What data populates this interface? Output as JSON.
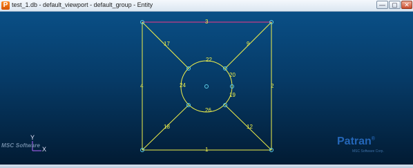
{
  "window": {
    "title": "test_1.db - default_viewport - default_group - Entity",
    "app_icon": "P",
    "buttons": [
      {
        "name": "minimize-button",
        "glyph": "—"
      },
      {
        "name": "maximize-button",
        "glyph": "▢"
      },
      {
        "name": "close-button",
        "glyph": "✕"
      }
    ]
  },
  "model": {
    "line_color": "#f0f04a",
    "top_edge_color": "#c23c86",
    "node_color": "#5fd0e8",
    "labels": {
      "top": "3",
      "bottom": "1",
      "left": "4",
      "right": "2",
      "diag_tl": "17",
      "diag_tr": "9",
      "diag_bl": "18",
      "diag_br": "12",
      "arc_top": "22",
      "arc_left": "24",
      "arc_upper_right": "20",
      "arc_lower_right": "19",
      "arc_bottom": "26"
    }
  },
  "triad": {
    "x_label": "X",
    "y_label": "Y"
  },
  "branding": {
    "msc": "MSC Software",
    "patran": "Patran",
    "patran_mark": "®",
    "patran_sub": "MSC Software Corp."
  }
}
